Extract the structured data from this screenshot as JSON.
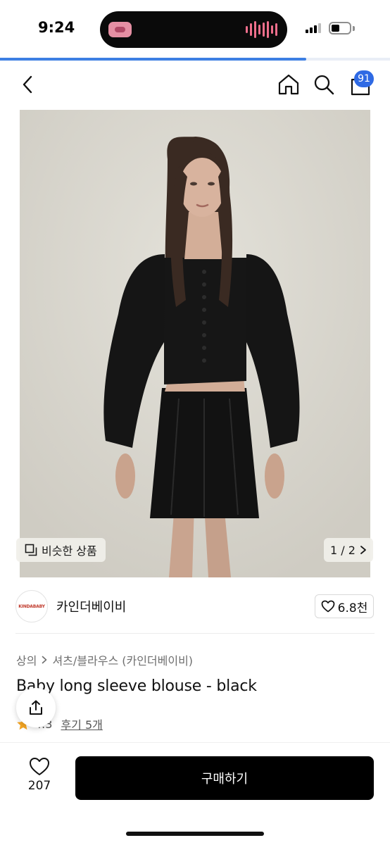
{
  "status_bar": {
    "time": "9:24",
    "battery_level": 0.45
  },
  "page_load_progress": 0.785,
  "header": {
    "cart_count": "91"
  },
  "gallery": {
    "similar_label": "비슷한 상품",
    "page_indicator": "1 / 2"
  },
  "brand": {
    "logo_text": "KINDABABY",
    "name": "카인더베이비",
    "likes": "6.8천"
  },
  "breadcrumb": {
    "category": "상의",
    "subcategory": "셔츠/블라우스 (카인더베이비)"
  },
  "product": {
    "title": "Baby long sleeve blouse - black",
    "rating": "4.3",
    "reviews": "후기 5개"
  },
  "bottom": {
    "wish_count": "207",
    "buy_label": "구매하기"
  },
  "colors": {
    "accent": "#2f6ae4",
    "progress": "#3d7fe3",
    "star": "#f5a623"
  }
}
